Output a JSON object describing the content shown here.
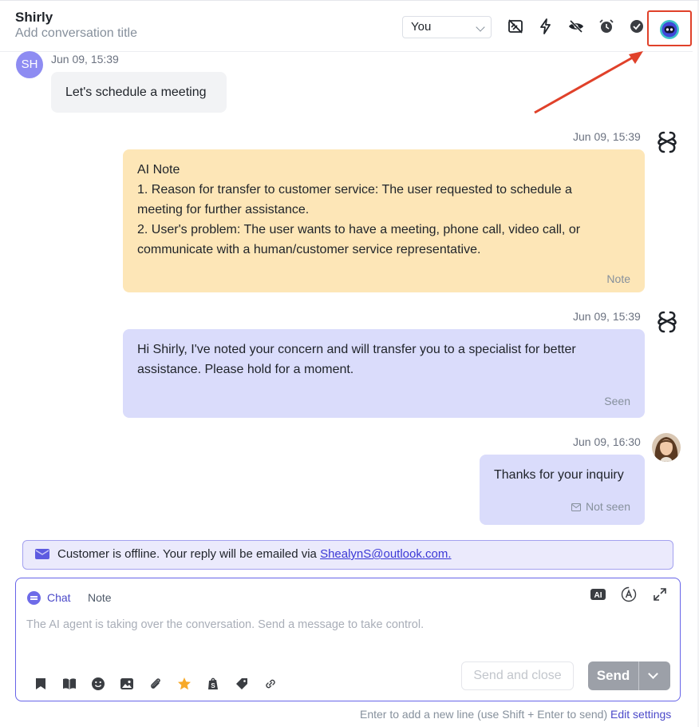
{
  "header": {
    "contact_name": "Shirly",
    "title_placeholder": "Add conversation title",
    "assignee": "You"
  },
  "messages": [
    {
      "sender_initials": "SH",
      "timestamp": "Jun 09, 15:39",
      "text": "Let's schedule a meeting"
    },
    {
      "timestamp": "Jun 09, 15:39",
      "lines": [
        "AI Note",
        "1. Reason for transfer to customer service: The user requested to schedule a",
        "meeting for further assistance.",
        "2. User's problem: The user wants to have a meeting, phone call, video call, or",
        "communicate with a human/customer service representative."
      ],
      "tag": "Note"
    },
    {
      "timestamp": "Jun 09, 15:39",
      "lines": [
        "Hi Shirly, I've noted your concern and will transfer you to a specialist for better",
        "assistance. Please hold for a moment."
      ],
      "status": "Seen"
    },
    {
      "timestamp": "Jun 09, 16:30",
      "text": "Thanks for your inquiry",
      "status": "Not seen"
    }
  ],
  "banner": {
    "text": "Customer is offline. Your reply will be emailed via ",
    "email": "ShealynS@outlook.com."
  },
  "composer": {
    "tab_chat": "Chat",
    "tab_note": "Note",
    "placeholder": "The AI agent is taking over the conversation. Send a message to take control.",
    "ai_badge": "AI",
    "send_close_label": "Send and close",
    "send_label": "Send"
  },
  "footer": {
    "hint": "Enter to add a new line (use Shift + Enter to send) ",
    "edit_link": "Edit settings"
  },
  "colors": {
    "accent": "#6764e8",
    "note_bubble": "#fde6b7",
    "agent_bubble": "#dadcfb",
    "customer_bubble": "#f2f3f5",
    "highlight_box": "#e0412a"
  }
}
